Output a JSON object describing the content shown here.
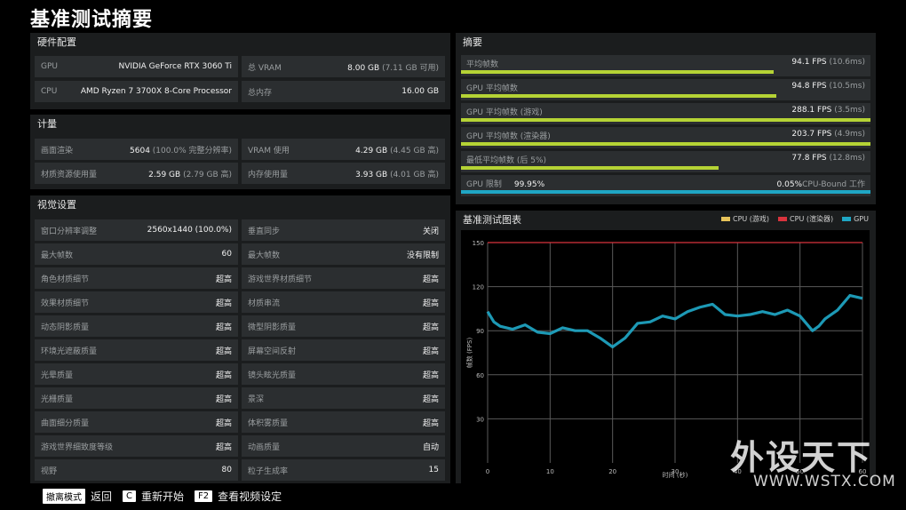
{
  "page_title": "基准测试摘要",
  "hardware": {
    "title": "硬件配置",
    "rows": [
      {
        "k": "GPU",
        "v": "NVIDIA GeForce RTX 3060 Ti",
        "sub": ""
      },
      {
        "k": "总 VRAM",
        "v": "8.00 GB",
        "sub": " (7.11 GB 可用)"
      },
      {
        "k": "CPU",
        "v": "AMD Ryzen 7 3700X 8-Core Processor",
        "sub": ""
      },
      {
        "k": "总内存",
        "v": "16.00 GB",
        "sub": ""
      }
    ]
  },
  "metrics": {
    "title": "计量",
    "rows": [
      {
        "k": "画面渲染",
        "v": "5604",
        "sub": " (100.0% 完整分辨率)"
      },
      {
        "k": "VRAM 使用",
        "v": "4.29 GB",
        "sub": " (4.45 GB 高)"
      },
      {
        "k": "材质资源使用量",
        "v": "2.59 GB",
        "sub": " (2.79 GB 高)"
      },
      {
        "k": "内存使用量",
        "v": "3.93 GB",
        "sub": " (4.01 GB 高)"
      }
    ]
  },
  "visual": {
    "title": "视觉设置",
    "rows": [
      {
        "k": "窗口分辨率调整",
        "v": "2560x1440 (100.0%)"
      },
      {
        "k": "垂直同步",
        "v": "关闭"
      },
      {
        "k": "最大帧数",
        "v": "60"
      },
      {
        "k": "最大帧数",
        "v": "没有限制"
      },
      {
        "k": "角色材质细节",
        "v": "超高"
      },
      {
        "k": "游戏世界材质细节",
        "v": "超高"
      },
      {
        "k": "效果材质细节",
        "v": "超高"
      },
      {
        "k": "材质串流",
        "v": "超高"
      },
      {
        "k": "动态阴影质量",
        "v": "超高"
      },
      {
        "k": "微型阴影质量",
        "v": "超高"
      },
      {
        "k": "环境光遮蔽质量",
        "v": "超高"
      },
      {
        "k": "屏幕空间反射",
        "v": "超高"
      },
      {
        "k": "光晕质量",
        "v": "超高"
      },
      {
        "k": "镜头眩光质量",
        "v": "超高"
      },
      {
        "k": "光栅质量",
        "v": "超高"
      },
      {
        "k": "景深",
        "v": "超高"
      },
      {
        "k": "曲面细分质量",
        "v": "超高"
      },
      {
        "k": "体积雾质量",
        "v": "超高"
      },
      {
        "k": "游戏世界细致度等级",
        "v": "超高"
      },
      {
        "k": "动画质量",
        "v": "自动"
      },
      {
        "k": "视野",
        "v": "80"
      },
      {
        "k": "粒子生成率",
        "v": "15"
      }
    ]
  },
  "summary": {
    "title": "摘要",
    "rows": [
      {
        "label": "平均帧数",
        "value": "94.1 FPS",
        "sub": " (10.6ms)",
        "fill": 0.764
      },
      {
        "label": "GPU 平均帧数",
        "value": "94.8 FPS",
        "sub": " (10.5ms)",
        "fill": 0.77
      },
      {
        "label": "GPU 平均帧数 (游戏)",
        "value": "288.1 FPS",
        "sub": " (3.5ms)",
        "fill": 1.0
      },
      {
        "label": "GPU 平均帧数 (渲染器)",
        "value": "203.7 FPS",
        "sub": " (4.9ms)",
        "fill": 1.0
      },
      {
        "label": "最低平均帧数 (后 5%)",
        "value": "77.8 FPS",
        "sub": " (12.8ms)",
        "fill": 0.63
      }
    ],
    "gpu_limit": {
      "label": "GPU 限制",
      "pct": "99.95%",
      "cpu_pct": "0.05%",
      "cpu_label": "CPU-Bound 工作"
    },
    "bar_color": "#b5d335",
    "gpu_bar_color": "#1fa6c4"
  },
  "chart_panel": {
    "title": "基准测试图表",
    "legend": [
      {
        "name": "CPU (游戏)",
        "color": "#e7c35a"
      },
      {
        "name": "CPU (渲染器)",
        "color": "#d9333d"
      },
      {
        "name": "GPU",
        "color": "#1fa6c4"
      }
    ]
  },
  "chart_data": {
    "type": "line",
    "title": "基准测试图表",
    "xlabel": "时间 (秒)",
    "ylabel": "帧数 (FPS)",
    "xlim": [
      0,
      60
    ],
    "ylim": [
      0,
      150
    ],
    "xticks": [
      0,
      10,
      20,
      30,
      40,
      50,
      60
    ],
    "yticks": [
      30,
      60,
      90,
      120,
      150
    ],
    "grid": true,
    "legend_position": "top-right",
    "series": [
      {
        "name": "CPU (游戏)",
        "values": []
      },
      {
        "name": "CPU (渲染器)",
        "x": [
          0,
          60
        ],
        "values": [
          150,
          150
        ]
      },
      {
        "name": "GPU",
        "x": [
          0,
          1,
          2,
          4,
          6,
          8,
          10,
          12,
          14,
          16,
          18,
          20,
          22,
          24,
          26,
          28,
          30,
          32,
          34,
          36,
          38,
          40,
          42,
          44,
          46,
          48,
          50,
          52,
          53,
          54,
          56,
          58,
          60
        ],
        "values": [
          103,
          96,
          93,
          91,
          94,
          89,
          88,
          92,
          90,
          90,
          85,
          79,
          85,
          95,
          96,
          100,
          98,
          103,
          106,
          108,
          101,
          100,
          101,
          103,
          101,
          104,
          100,
          90,
          93,
          98,
          104,
          114,
          112
        ]
      }
    ]
  },
  "footer": [
    {
      "key": "撤离模式",
      "action": "返回"
    },
    {
      "key": "C",
      "action": "重新开始"
    },
    {
      "key": "F2",
      "action": "查看视频设定"
    }
  ],
  "watermark": {
    "big": "外设天下",
    "small": "WWW.WSTX.COM"
  }
}
